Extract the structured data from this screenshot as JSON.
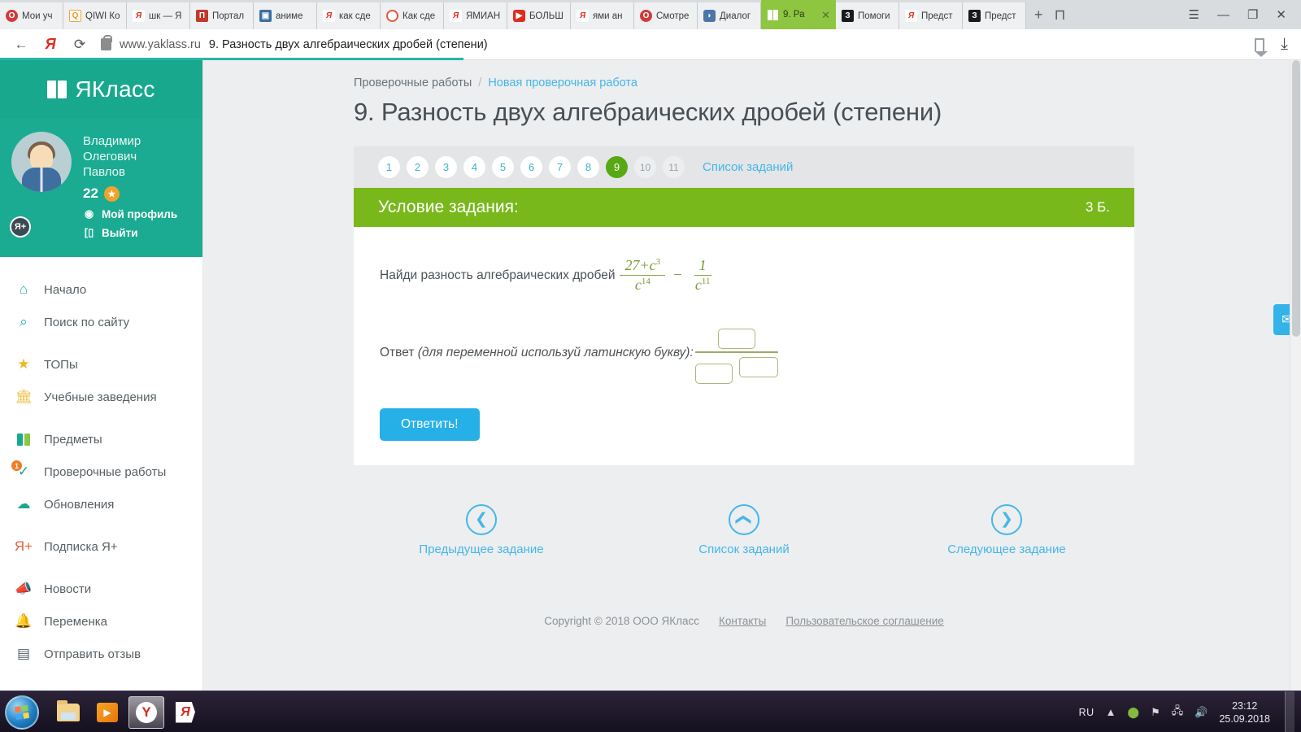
{
  "browser": {
    "tabs": [
      {
        "label": "Мои уч",
        "favicon": "opera-icon",
        "fav_class": "f-opera",
        "fav_text": "O",
        "active": false
      },
      {
        "label": "QIWI Ко",
        "favicon": "qiwi-icon",
        "fav_class": "f-qiwi",
        "fav_text": "Q",
        "active": false
      },
      {
        "label": "шк — Я",
        "favicon": "yandex-icon",
        "fav_class": "f-ya",
        "fav_text": "Я",
        "active": false
      },
      {
        "label": "Портал",
        "favicon": "portal-icon",
        "fav_class": "f-portal",
        "fav_text": "П",
        "active": false
      },
      {
        "label": "аниме",
        "favicon": "image-icon",
        "fav_class": "f-anime",
        "fav_text": "▣",
        "active": false
      },
      {
        "label": "как сде",
        "favicon": "yandex-icon",
        "fav_class": "f-ya",
        "fav_text": "Я",
        "active": false
      },
      {
        "label": "Как сде",
        "favicon": "circle-icon",
        "fav_class": "f-circ",
        "fav_text": "",
        "active": false
      },
      {
        "label": "ЯМИАН",
        "favicon": "yandex-icon",
        "fav_class": "f-ya",
        "fav_text": "Я",
        "active": false
      },
      {
        "label": "БОЛЬШ",
        "favicon": "youtube-icon",
        "fav_class": "f-yt",
        "fav_text": "▶",
        "active": false
      },
      {
        "label": "ями ан",
        "favicon": "yandex-icon",
        "fav_class": "f-ya",
        "fav_text": "Я",
        "active": false
      },
      {
        "label": "Смотре",
        "favicon": "opera-icon",
        "fav_class": "f-opera",
        "fav_text": "O",
        "active": false
      },
      {
        "label": "Диалог",
        "favicon": "vk-icon",
        "fav_class": "f-vk",
        "fav_text": "◗",
        "active": false
      },
      {
        "label": "9. Ра",
        "favicon": "yaklass-book-icon",
        "fav_class": "f-yak",
        "fav_text": "",
        "active": true,
        "close_label": "✕"
      },
      {
        "label": "Помоги",
        "favicon": "znanija-icon",
        "fav_class": "f-dark",
        "fav_text": "З",
        "active": false
      },
      {
        "label": "Предст",
        "favicon": "yandex-icon",
        "fav_class": "f-ya",
        "fav_text": "Я",
        "active": false
      },
      {
        "label": "Предст",
        "favicon": "znanija-icon",
        "fav_class": "f-dark",
        "fav_text": "З",
        "active": false
      }
    ],
    "new_tab_label": "+",
    "tab_list_label": "⊓",
    "menu_label": "☰",
    "minimize_label": "—",
    "restore_label": "❐",
    "close_label": "✕",
    "back_label": "←",
    "yandex_label": "Я",
    "reload_label": "⟳",
    "url_domain": "www.yaklass.ru",
    "url_title": "9. Разность двух алгебраических дробей (степени)",
    "download_label": "⤓"
  },
  "sidebar": {
    "logo_text": "ЯКласс",
    "user": {
      "name_line1": "Владимир",
      "name_line2": "Олегович",
      "name_line3": "Павлов",
      "points": "22",
      "star_glyph": "★",
      "plus_badge": "Я+",
      "profile_label": "Мой профиль",
      "profile_icon": "user-circle-icon",
      "logout_label": "Выйти",
      "logout_icon": "exit-icon"
    },
    "groups": [
      {
        "items": [
          {
            "label": "Начало",
            "icon": "home-icon",
            "glyph": "⌂",
            "ic_class": "ic-home",
            "badge": ""
          },
          {
            "label": "Поиск по сайту",
            "icon": "search-icon",
            "glyph": "⌕",
            "ic_class": "ic-search",
            "badge": ""
          }
        ]
      },
      {
        "items": [
          {
            "label": "ТОПы",
            "icon": "star-icon",
            "glyph": "★",
            "ic_class": "ic-star",
            "badge": ""
          },
          {
            "label": "Учебные заведения",
            "icon": "bank-icon",
            "glyph": "🏛",
            "ic_class": "ic-bank",
            "badge": ""
          }
        ]
      },
      {
        "items": [
          {
            "label": "Предметы",
            "icon": "books-icon",
            "glyph": "",
            "ic_class": "ic-books",
            "badge": ""
          },
          {
            "label": "Проверочные работы",
            "icon": "check-circle-icon",
            "glyph": "✓",
            "ic_class": "ic-check",
            "badge": "1"
          },
          {
            "label": "Обновления",
            "icon": "cloud-update-icon",
            "glyph": "☁",
            "ic_class": "ic-cloud",
            "badge": ""
          }
        ]
      },
      {
        "items": [
          {
            "label": "Подписка Я+",
            "icon": "yaplus-icon",
            "glyph": "Я+",
            "ic_class": "ic-plus",
            "badge": ""
          }
        ]
      },
      {
        "items": [
          {
            "label": "Новости",
            "icon": "megaphone-icon",
            "glyph": "📣",
            "ic_class": "ic-news",
            "badge": ""
          },
          {
            "label": "Переменка",
            "icon": "bell-icon",
            "glyph": "🔔",
            "ic_class": "ic-bell",
            "badge": ""
          },
          {
            "label": "Отправить отзыв",
            "icon": "message-icon",
            "glyph": "▤",
            "ic_class": "ic-msg",
            "badge": ""
          }
        ]
      }
    ]
  },
  "main": {
    "breadcrumb": {
      "root": "Проверочные работы",
      "separator": "/",
      "current": "Новая проверочная работа"
    },
    "page_title": "9. Разность двух алгебраических дробей (степени)",
    "question_nav": {
      "numbers": [
        "1",
        "2",
        "3",
        "4",
        "5",
        "6",
        "7",
        "8",
        "9",
        "10",
        "11"
      ],
      "active": "9",
      "muted_from": 9,
      "list_link": "Список заданий"
    },
    "task": {
      "header_title": "Условие задания:",
      "points": "3 Б.",
      "prompt": "Найди разность алгебраических дробей",
      "formula": {
        "fraction1": {
          "numerator": "27 + c³",
          "denominator": "c¹⁴",
          "num_a": "27",
          "num_op": "+",
          "num_var": "c",
          "num_exp": "3",
          "den_var": "c",
          "den_exp": "14"
        },
        "operator": "−",
        "fraction2": {
          "numerator": "1",
          "denominator": "c¹¹",
          "num": "1",
          "den_var": "c",
          "den_exp": "11"
        }
      },
      "answer_label": "Ответ",
      "answer_hint": "(для переменной используй латинскую букву):",
      "answer_inputs": {
        "numerator_value": "",
        "numerator_placeholder": "",
        "denominator_base_value": "",
        "denominator_base_placeholder": "",
        "denominator_exp_value": "",
        "denominator_exp_placeholder": ""
      },
      "submit_label": "Ответить!"
    },
    "nav_actions": [
      {
        "label": "Предыдущее задание",
        "icon": "chevron-left-icon",
        "glyph": "❮"
      },
      {
        "label": "Список заданий",
        "icon": "chevron-up-icon",
        "glyph": "❮"
      },
      {
        "label": "Следующее задание",
        "icon": "chevron-right-icon",
        "glyph": "❯"
      }
    ],
    "footer": {
      "copyright": "Copyright © 2018 ООО ЯКласс",
      "contacts": "Контакты",
      "agreement": "Пользовательское соглашение"
    },
    "feedback_tab_icon": "mail-icon",
    "feedback_tab_glyph": "✉"
  },
  "taskbar": {
    "start_label": "start-orb",
    "items": [
      {
        "name": "explorer",
        "icon": "folder-icon"
      },
      {
        "name": "media-player",
        "icon": "play-icon",
        "glyph": "▶"
      },
      {
        "name": "yandex-browser",
        "icon": "yandex-browser-icon",
        "glyph": "Y"
      },
      {
        "name": "yandex",
        "icon": "yandex-icon",
        "glyph": "Я"
      }
    ],
    "tray": {
      "language": "RU",
      "expand_glyph": "▲",
      "shield_glyph": "⬇",
      "flag_glyph": "⚑",
      "network_glyph": "🖧",
      "volume_glyph": "🔊",
      "time": "23:12",
      "date": "25.09.2018"
    }
  },
  "colors": {
    "brand_teal": "#18a88e",
    "accent_green": "#78b81b",
    "active_green": "#58a813",
    "link_blue": "#45b6e8",
    "button_blue": "#25b0e8",
    "formula_green": "#7a9b34",
    "tab_active_green": "#8ec641"
  }
}
